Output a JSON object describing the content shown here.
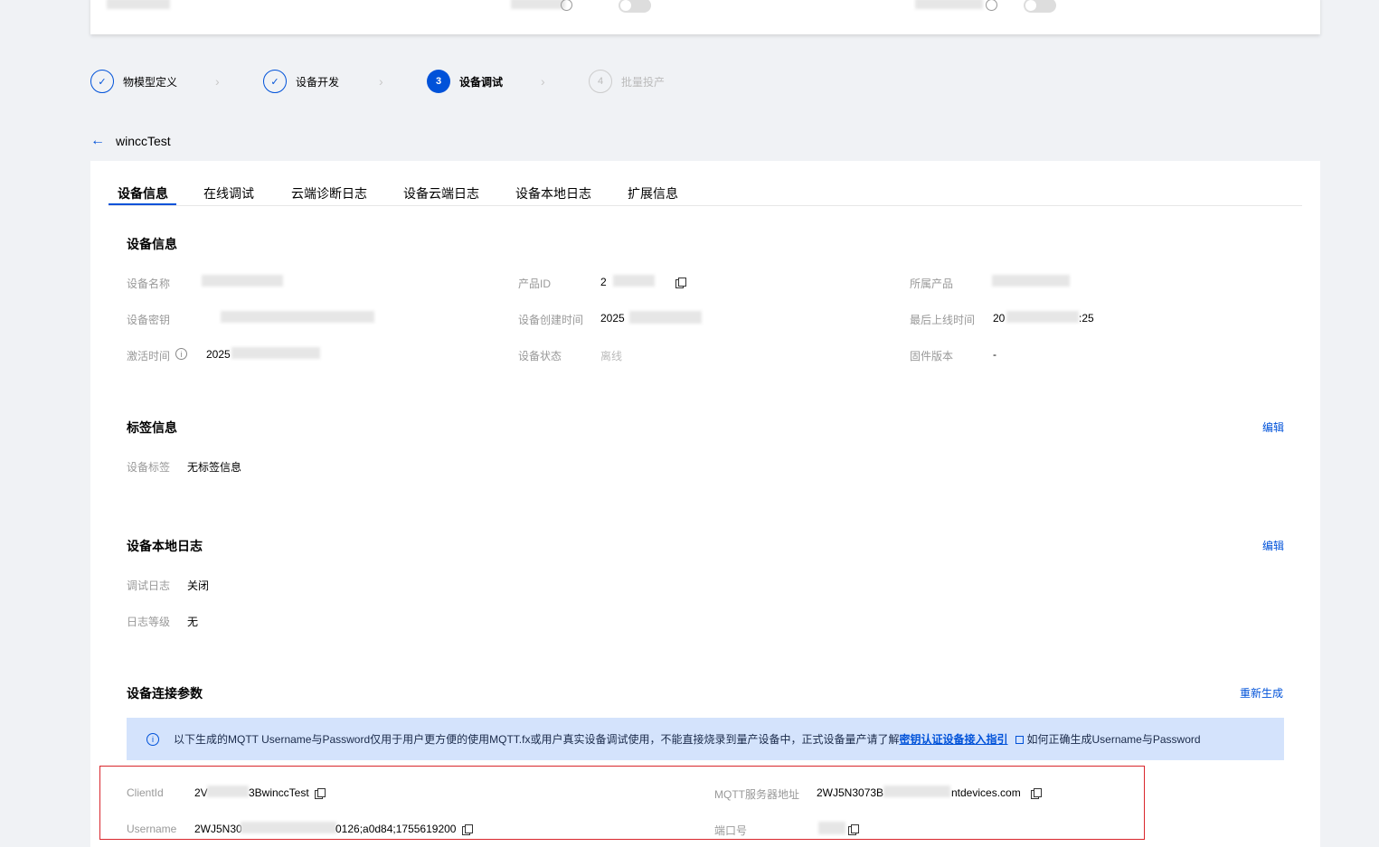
{
  "steps": [
    {
      "num": "✓",
      "label": "物模型定义",
      "state": "done"
    },
    {
      "num": "✓",
      "label": "设备开发",
      "state": "done"
    },
    {
      "num": "3",
      "label": "设备调试",
      "state": "active"
    },
    {
      "num": "4",
      "label": "批量投产",
      "state": "todo"
    }
  ],
  "header": {
    "back_title": "winccTest"
  },
  "tabs": [
    "设备信息",
    "在线调试",
    "云端诊断日志",
    "设备云端日志",
    "设备本地日志",
    "扩展信息"
  ],
  "device_info": {
    "title": "设备信息",
    "name_label": "设备名称",
    "name_value": "",
    "key_label": "设备密钥",
    "activation_label": "激活时间",
    "activation_value": "2025",
    "product_id_label": "产品ID",
    "product_id_value": "2",
    "create_time_label": "设备创建时间",
    "create_time_value": "2025",
    "status_label": "设备状态",
    "status_value": "离线",
    "product_label": "所属产品",
    "last_online_label": "最后上线时间",
    "last_online_value_a": "20",
    "last_online_value_b": ":25",
    "firmware_label": "固件版本",
    "firmware_value": "-"
  },
  "tags": {
    "title": "标签信息",
    "edit": "编辑",
    "label": "设备标签",
    "value": "无标签信息"
  },
  "local_log": {
    "title": "设备本地日志",
    "edit": "编辑",
    "debug_label": "调试日志",
    "debug_value": "关闭",
    "level_label": "日志等级",
    "level_value": "无"
  },
  "connection": {
    "title": "设备连接参数",
    "regenerate": "重新生成",
    "notice_text": "以下生成的MQTT Username与Password仅用于用户更方便的使用MQTT.fx或用户真实设备调试使用，不能直接烧录到量产设备中，正式设备量产请了解",
    "notice_link1": "密钥认证设备接入指引",
    "notice_link2": "如何正确生成Username与Password",
    "client_id_label": "ClientId",
    "client_id_value_a": "2V",
    "client_id_value_b": "3BwinccTest",
    "mqtt_label": "MQTT服务器地址",
    "mqtt_value_a": "2WJ5N3073B",
    "mqtt_value_b": "ntdevices.com",
    "username_label": "Username",
    "username_value_a": "2WJ5N30",
    "username_value_b": "0126;a0d84;1755619200",
    "port_label": "端口号"
  }
}
